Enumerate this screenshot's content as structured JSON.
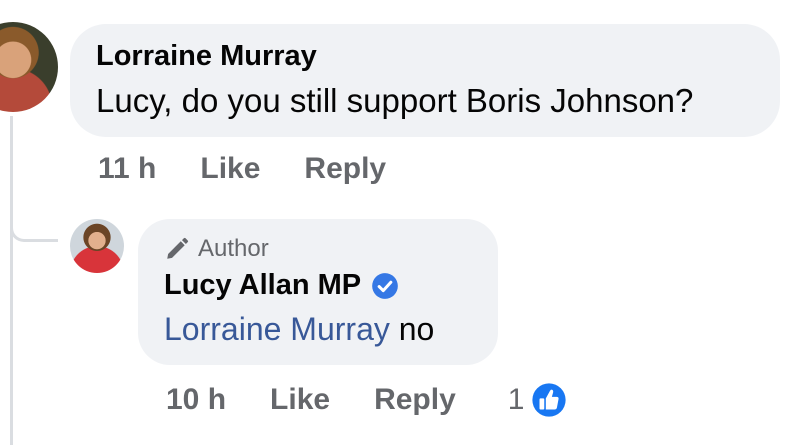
{
  "comment": {
    "author": "Lorraine Murray",
    "text": "Lucy, do you still support Boris Johnson?",
    "time": "11 h",
    "like_label": "Like",
    "reply_label": "Reply"
  },
  "reply": {
    "badge_label": "Author",
    "author": "Lucy Allan MP",
    "verified": true,
    "mention": "Lorraine Murray",
    "text": " no",
    "time": "10 h",
    "like_label": "Like",
    "reply_label": "Reply",
    "reaction_count": "1",
    "reaction_type": "like-icon"
  },
  "colors": {
    "bubble": "#f0f2f5",
    "mention": "#385898",
    "secondary_text": "#65676b",
    "verified_blue": "#1877f2",
    "thread_line": "#dadde1"
  }
}
